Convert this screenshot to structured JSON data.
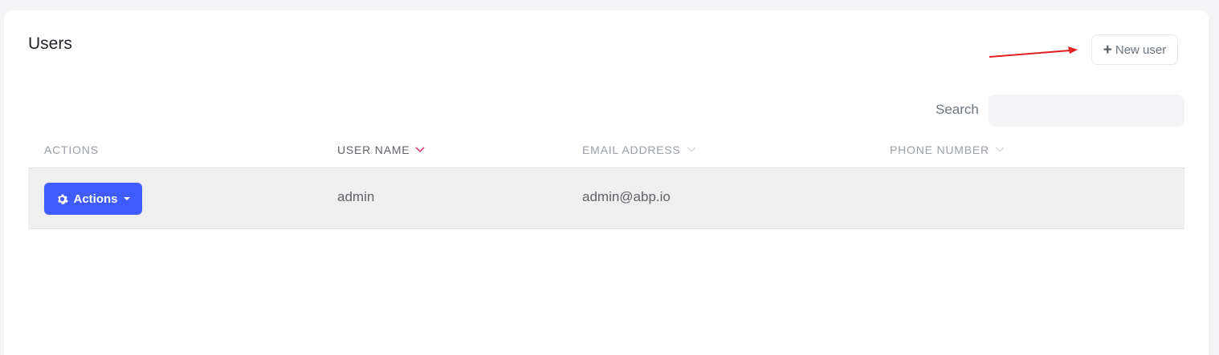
{
  "page": {
    "title": "Users"
  },
  "toolbar": {
    "new_user_icon": "plus-icon",
    "new_user_label": "New user"
  },
  "search": {
    "label": "Search",
    "value": ""
  },
  "table": {
    "columns": [
      {
        "label": "ACTIONS",
        "sortable": false
      },
      {
        "label": "USER NAME",
        "sortable": true,
        "sorted": true
      },
      {
        "label": "EMAIL ADDRESS",
        "sortable": true,
        "sorted": false
      },
      {
        "label": "PHONE NUMBER",
        "sortable": true,
        "sorted": false
      }
    ],
    "rows": [
      {
        "actions_label": "Actions",
        "user_name": "admin",
        "email": "admin@abp.io",
        "phone": ""
      }
    ]
  },
  "colors": {
    "accent": "#3f5bfd",
    "sort_active": "#e0245e",
    "annotation_arrow": "#e02020"
  }
}
